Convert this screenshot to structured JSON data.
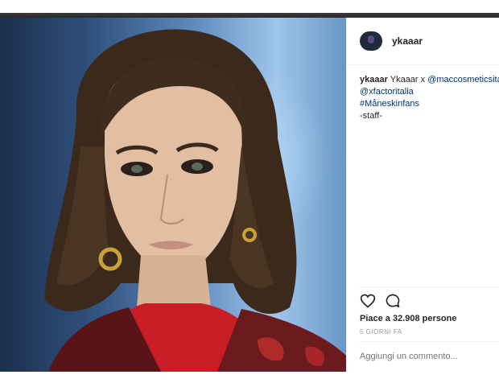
{
  "post": {
    "username": "ykaaar",
    "caption": {
      "author": "ykaaar",
      "text": "Ykaaar x",
      "mention_1": "@maccosmeticsitalia",
      "mention_2": "@xfactoritalia",
      "hashtag": "#Måneskinfans",
      "signature": "-staff-"
    },
    "likes_text": "Piace a 32.908 persone",
    "date": "5 GIORNI FA",
    "comment_placeholder": "Aggiungi un commento..."
  },
  "icons": {
    "like": "heart-outline-icon",
    "comment": "speech-bubble-icon"
  },
  "colors": {
    "link": "#003569",
    "meta": "#999999",
    "text": "#262626"
  }
}
